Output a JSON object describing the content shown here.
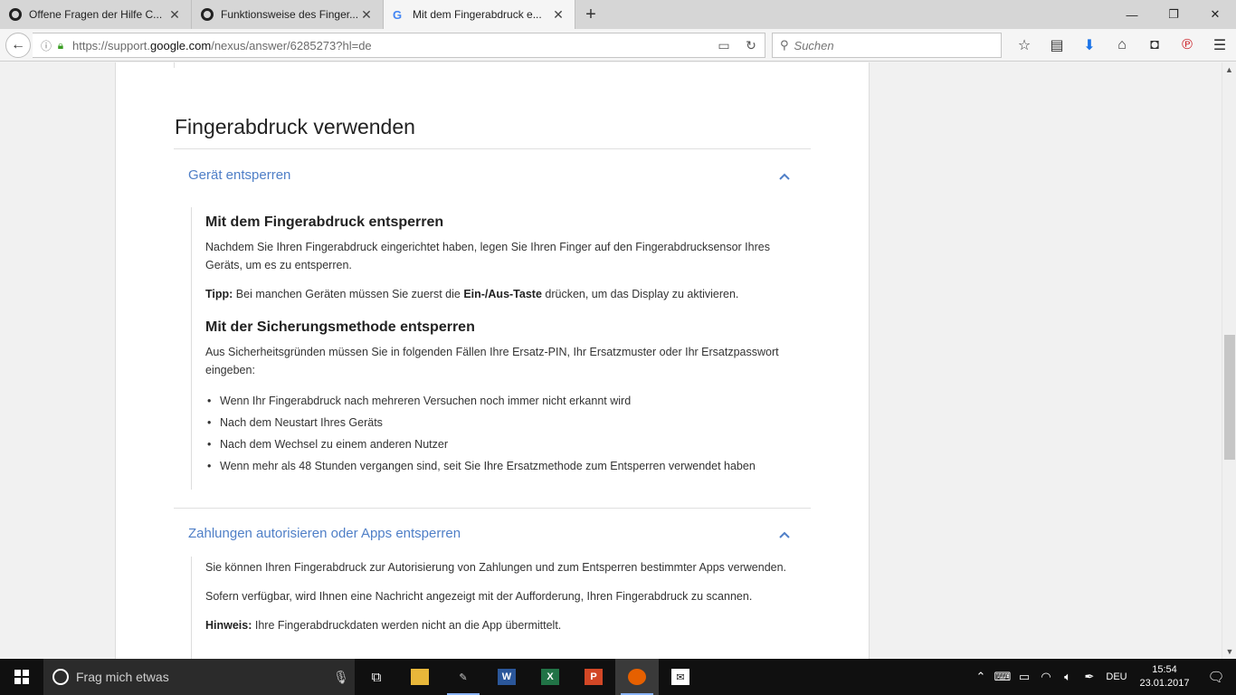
{
  "browser": {
    "tabs": [
      {
        "title": "Offene Fragen der Hilfe C...",
        "active": false
      },
      {
        "title": "Funktionsweise des Finger...",
        "active": false
      },
      {
        "title": "Mit dem Fingerabdruck e...",
        "active": true
      }
    ],
    "url_prefix": "https://support.",
    "url_domain": "google.com",
    "url_path": "/nexus/answer/6285273?hl=de",
    "search_placeholder": "Suchen"
  },
  "page": {
    "heading": "Fingerabdruck verwenden",
    "sections": [
      {
        "title": "Gerät entsperren",
        "sub1_heading": "Mit dem Fingerabdruck entsperren",
        "sub1_p1": "Nachdem Sie Ihren Fingerabdruck eingerichtet haben, legen Sie Ihren Finger auf den Fingerabdrucksensor Ihres Geräts, um es zu entsperren.",
        "tip_label": "Tipp:",
        "tip_text_a": " Bei manchen Geräten müssen Sie zuerst die ",
        "tip_bold": "Ein-/Aus-Taste",
        "tip_text_b": " drücken, um das Display zu aktivieren.",
        "sub2_heading": "Mit der Sicherungsmethode entsperren",
        "sub2_p1": "Aus Sicherheitsgründen müssen Sie in folgenden Fällen Ihre Ersatz-PIN, Ihr Ersatzmuster oder Ihr Ersatzpasswort eingeben:",
        "bullets": [
          "Wenn Ihr Fingerabdruck nach mehreren Versuchen noch immer nicht erkannt wird",
          "Nach dem Neustart Ihres Geräts",
          "Nach dem Wechsel zu einem anderen Nutzer",
          "Wenn mehr als 48 Stunden vergangen sind, seit Sie Ihre Ersatzmethode zum Entsperren verwendet haben"
        ]
      },
      {
        "title": "Zahlungen autorisieren oder Apps entsperren",
        "p1": "Sie können Ihren Fingerabdruck zur Autorisierung von Zahlungen und zum Entsperren bestimmter Apps verwenden.",
        "p2": "Sofern verfügbar, wird Ihnen eine Nachricht angezeigt mit der Aufforderung, Ihren Fingerabdruck zu scannen.",
        "note_label": "Hinweis:",
        "note_text": " Ihre Fingerabdruckdaten werden nicht an die App übermittelt."
      }
    ]
  },
  "taskbar": {
    "search_text": "Frag mich etwas",
    "lang": "DEU",
    "time": "15:54",
    "date": "23.01.2017"
  },
  "colors": {
    "link": "#4f7fc7",
    "taskbar": "#101010"
  }
}
